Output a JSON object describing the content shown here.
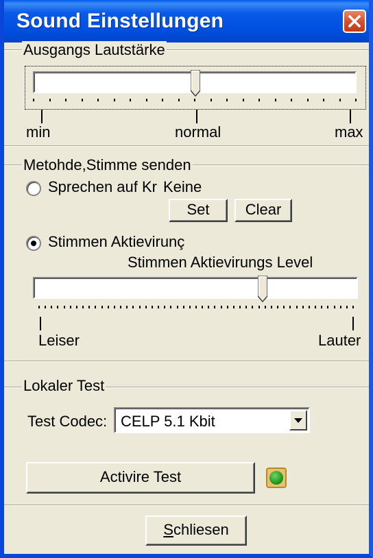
{
  "window": {
    "title": "Sound Einstellungen",
    "close_icon": "close-x-icon",
    "titlebar_color": "#0a5ae8",
    "close_color": "#d7502f"
  },
  "output_volume": {
    "legend": "Ausgangs Lautstärke",
    "label_min": "min",
    "label_normal": "normal",
    "label_max": "max",
    "level_fraction": 0.5
  },
  "send_method": {
    "legend": "Metohde,Stimme senden",
    "option_ptt_label": "Sprechen auf Kr",
    "ptt_key_value": "Keine",
    "set_button": "Set",
    "clear_button": "Clear",
    "option_va_label": "Stimmen Aktievirunç",
    "selected_option": "Stimmen Aktievirunç",
    "va_level_title": "Stimmen Aktievirungs Level",
    "label_quieter": "Leiser",
    "label_louder": "Lauter",
    "va_level_fraction": 0.71
  },
  "local_test": {
    "legend": "Lokaler Test",
    "codec_label": "Test Codec:",
    "codec_value": "CELP 5.1 Kbit",
    "activate_button": "Activire Test",
    "status_led": "green",
    "status_led_color": "#1f9a1a"
  },
  "footer": {
    "close_button": "Schliesen"
  }
}
